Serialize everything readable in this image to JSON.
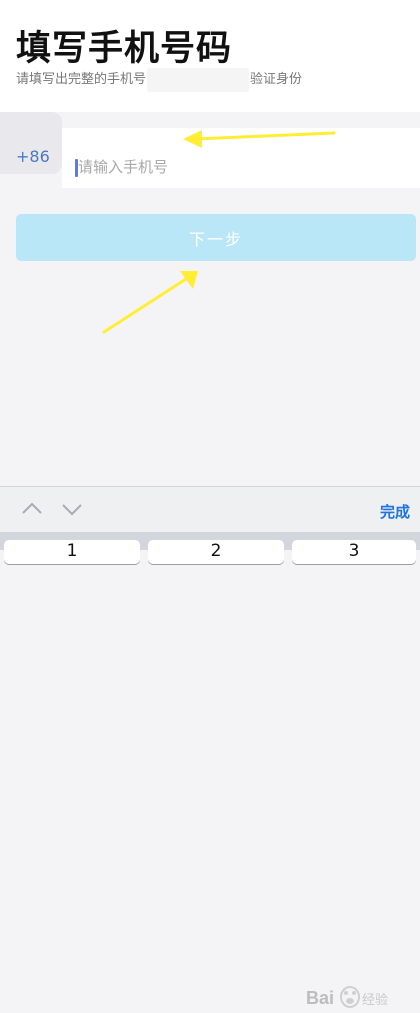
{
  "header": {
    "title": "填写手机号码",
    "subtitle_prefix": "请填写出完整的手机号",
    "subtitle_suffix": "验证身份"
  },
  "phone": {
    "country_code": "+86",
    "placeholder": "请输入手机号",
    "value": ""
  },
  "next_button": {
    "label": "下一步",
    "enabled": false
  },
  "annotations": {
    "arrow_color": "#ffee33"
  },
  "keyboard": {
    "prev_icon": "chevron-up-icon",
    "next_icon": "chevron-down-icon",
    "done_label": "完成",
    "keys": [
      "1",
      "2",
      "3"
    ]
  },
  "colors": {
    "accent": "#1e73e6",
    "button_disabled": "#b9e7f8",
    "country_code": "#4a78c8"
  }
}
